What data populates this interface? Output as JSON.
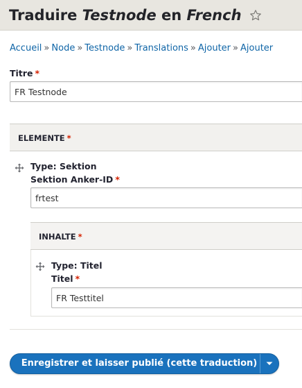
{
  "header": {
    "title_prefix": "Traduire",
    "node_name": "Testnode",
    "title_middle": "en",
    "language": "French",
    "star_icon": "star-outline-icon"
  },
  "breadcrumb": [
    "Accueil",
    "Node",
    "Testnode",
    "Translations",
    "Ajouter",
    "Ajouter"
  ],
  "breadcrumb_separator": "»",
  "required_marker": "*",
  "title_field": {
    "label": "Titre",
    "value": "FR Testnode"
  },
  "elemente": {
    "label": "ELEMENTE",
    "item": {
      "type_label": "Type: Sektion",
      "anchor_label": "Sektion Anker-ID",
      "anchor_value": "frtest"
    }
  },
  "inhalte": {
    "label": "INHALTE",
    "item": {
      "type_label": "Type: Titel",
      "titel_label": "Titel",
      "titel_value": "FR Testtitel"
    }
  },
  "save_button": {
    "label": "Enregistrer et laisser publié (cette traduction)",
    "toggle_icon": "chevron-down-icon"
  },
  "colors": {
    "accent": "#1a72bd",
    "link": "#0f65a7",
    "required": "#d52100",
    "header_bg": "#e8e6e0"
  }
}
